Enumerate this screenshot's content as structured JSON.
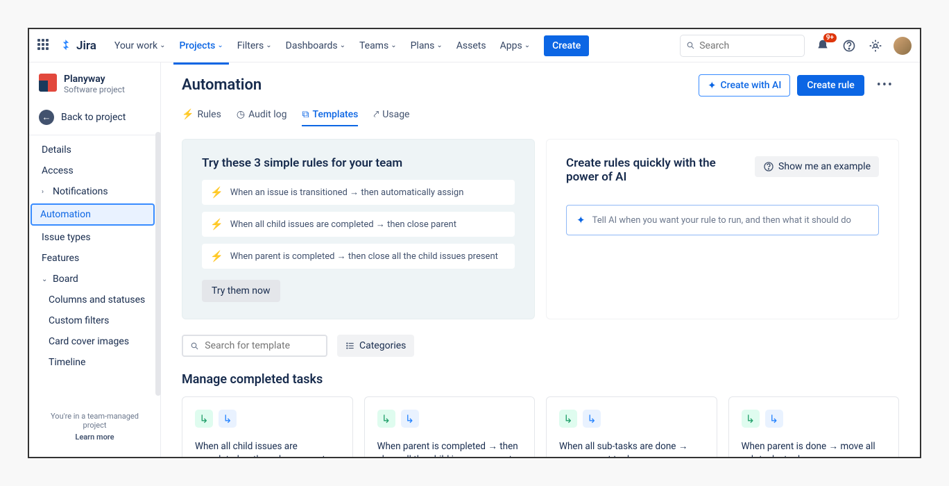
{
  "brand": "Jira",
  "nav": {
    "items": [
      {
        "label": "Your work",
        "active": false
      },
      {
        "label": "Projects",
        "active": true
      },
      {
        "label": "Filters",
        "active": false
      },
      {
        "label": "Dashboards",
        "active": false
      },
      {
        "label": "Teams",
        "active": false
      },
      {
        "label": "Plans",
        "active": false
      },
      {
        "label": "Assets",
        "active": false,
        "no_chev": true
      },
      {
        "label": "Apps",
        "active": false
      }
    ],
    "create": "Create",
    "search_placeholder": "Search",
    "notif_badge": "9+"
  },
  "sidebar": {
    "project_name": "Planyway",
    "project_type": "Software project",
    "back": "Back to project",
    "items": [
      {
        "label": "Details"
      },
      {
        "label": "Access"
      },
      {
        "label": "Notifications",
        "exp": "›"
      },
      {
        "label": "Automation",
        "selected": true
      },
      {
        "label": "Issue types"
      },
      {
        "label": "Features"
      },
      {
        "label": "Board",
        "exp": "⌄"
      },
      {
        "label": "Columns and statuses",
        "indent": true
      },
      {
        "label": "Custom filters",
        "indent": true
      },
      {
        "label": "Card cover images",
        "indent": true
      },
      {
        "label": "Timeline",
        "indent": true
      }
    ],
    "footer_line": "You're in a team-managed project",
    "footer_link": "Learn more"
  },
  "page": {
    "title": "Automation",
    "create_ai": "Create with AI",
    "create_rule": "Create rule"
  },
  "tabs": [
    {
      "label": "Rules"
    },
    {
      "label": "Audit log"
    },
    {
      "label": "Templates",
      "active": true
    },
    {
      "label": "Usage"
    }
  ],
  "try_panel": {
    "title": "Try these 3 simple rules for your team",
    "rules": [
      "When an issue is transitioned → then automatically assign",
      "When all child issues are completed → then close parent",
      "When parent is completed → then close all the child issues present"
    ],
    "button": "Try them now"
  },
  "ai_panel": {
    "title": "Create rules quickly with the power of AI",
    "example_btn": "Show me an example",
    "placeholder": "Tell AI when you want your rule to run, and then what it should do"
  },
  "filter": {
    "search_placeholder": "Search for template",
    "categories": "Categories"
  },
  "section": {
    "title": "Manage completed tasks",
    "cards": [
      "When all child issues are completed → then close parent",
      "When parent is completed → then close all the child issues present",
      "When all sub-tasks are done → move parent to done",
      "When parent is done → move all sub-tasks to done"
    ]
  }
}
